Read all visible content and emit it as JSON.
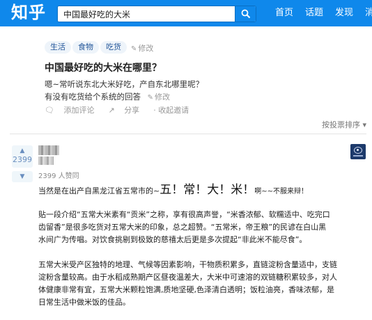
{
  "header": {
    "logo": "知乎",
    "search_value": "中国最好吃的大米",
    "nav": [
      "首页",
      "话题",
      "发现",
      "消"
    ]
  },
  "question": {
    "topics": [
      "生活",
      "食物",
      "吃货"
    ],
    "topics_edit": "修改",
    "title": "中国最好吃的大米在哪里？",
    "desc_line1": "嗯~常听说东北大米好吃，产自东北哪里呢？",
    "desc_line2": "有没有吃货给个系统的回答",
    "desc_edit": "修改",
    "add_comment": "添加评论",
    "share": "分享",
    "collapse_invite": "收起邀请",
    "sort": "按投票排序"
  },
  "answer": {
    "upvotes": "2399",
    "votes_line": "2399 人赞同",
    "line1_pre": "当然是在出产自黑龙江省五常市的~",
    "line1_big": "五！常！大！米！",
    "line1_post": "啊~~不服来辩！",
    "paragraph1": [
      "贴一段介绍“五常大米素有“贡米”之称，享有很高声誉，“米香浓郁、软糯适中、吃完口",
      "齿留香”是很多吃货对五常大米的印象，总之超赞。“五常米，帝王粮”的民谚在白山黑",
      "水间广为传唱。对饮食挑剔到极致的慈禧太后更是多次提起“非此米不能尽食”。"
    ],
    "paragraph2": [
      "五常大米受产区独特的地理、气候等因素影响，干物质积累多，直链淀粉含量适中，支链",
      "淀粉含量较高。由于水稻成熟期产区昼夜温差大，大米中可速溶的双链糖积累较多，对人",
      "体健康非常有宜，五常大米颗粒饱满,质地坚硬,色泽清白透明；饭粒油亮，香味浓郁，是",
      "日常生活中做米饭的佳品。"
    ]
  }
}
